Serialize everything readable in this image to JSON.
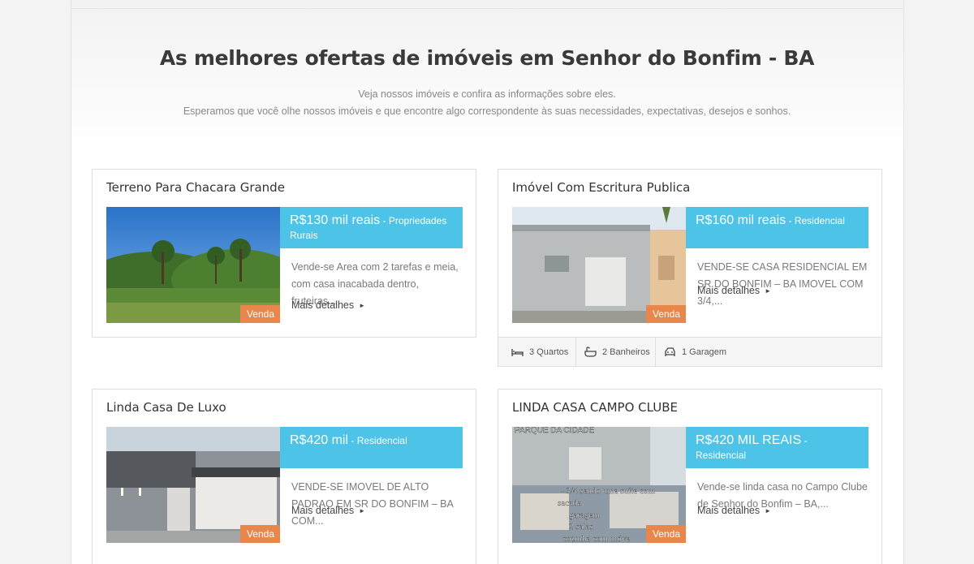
{
  "headline": "As melhores ofertas de imóveis em Senhor do Bonfim - BA",
  "subtitle_line1": "Veja nossos imóveis e confira as informações sobre eles.",
  "subtitle_line2": "Esperamos que você olhe nossos imóveis e que encontre algo correspondente às suas necessidades, expectativas, desejos e sonhos.",
  "colors": {
    "accent_blue": "#4cc3e7",
    "tag_orange": "#e8874b"
  },
  "listings": [
    {
      "title": "Terreno Para Chacara Grande",
      "price": "R$130 mil reais",
      "category": " - Propriedades Rurais",
      "description": "Vende-se Area com 2 tarefas e meia, com casa inacabada dentro, fruteiras...",
      "more_label": "Mais detalhes",
      "tag": "Venda"
    },
    {
      "title": "Imóvel Com Escritura Publica",
      "price": "R$160 mil reais",
      "category": " - Residencial",
      "description": "VENDE-SE CASA RESIDENCIAL EM SR DO BONFIM – BA IMOVEL COM 3/4,...",
      "more_label": "Mais detalhes",
      "tag": "Venda",
      "features": {
        "bedrooms": "3 Quartos",
        "bathrooms": "2 Banheiros",
        "garage": "1 Garagem"
      }
    },
    {
      "title": "Linda Casa De Luxo",
      "price": "R$420 mil",
      "category": " - Residencial",
      "description": "VENDE-SE IMOVEL DE ALTO PADRAO EM SR DO BONFIM – BA COM...",
      "more_label": "Mais detalhes",
      "tag": "Venda"
    },
    {
      "title": "LINDA CASA CAMPO CLUBE",
      "price": "R$420 MIL REAIS",
      "category": " - Residencial",
      "description": "Vende-se linda casa no Campo Clube de Senhor do Bonfim – BA,...",
      "more_label": "Mais detalhes",
      "tag": "Venda",
      "photo_overlay_top": "PARQUE DA CIDADE",
      "photo_overlay_lines": [
        "- 3/4 sendo uma suíte com",
        "sacada",
        "garagem",
        "2 salas",
        "cozinha com móve"
      ]
    }
  ]
}
